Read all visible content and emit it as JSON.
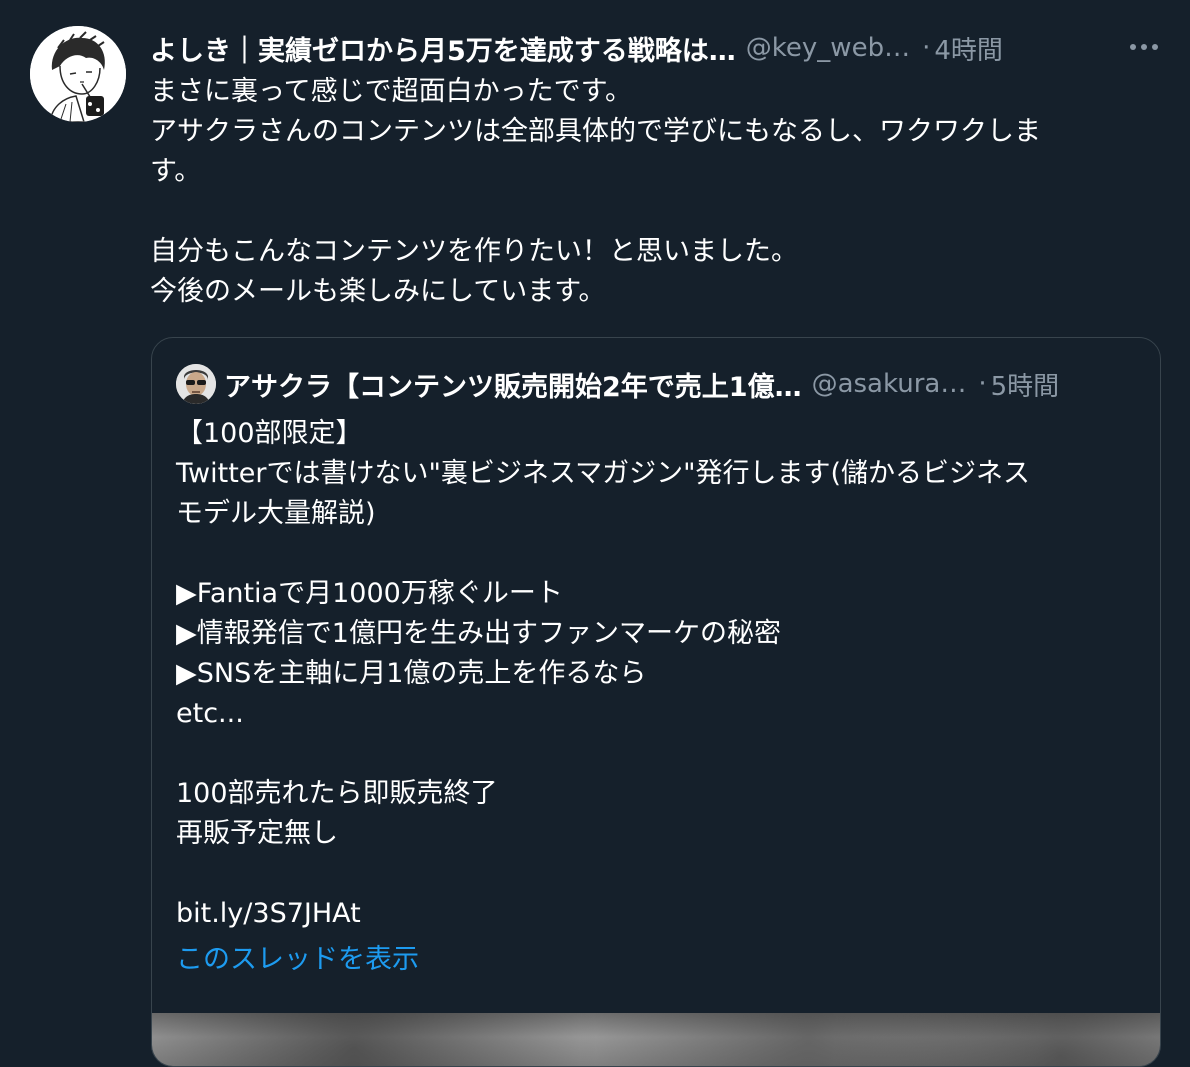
{
  "tweet": {
    "author_name": "よしき｜実績ゼロから月5万を達成する戦略は…",
    "author_handle": "@key_web…",
    "separator": "·",
    "time": "4時間",
    "body": "まさに裏って感じで超面白かったです。\nアサクラさんのコンテンツは全部具体的で学びにもなるし、ワクワクしま\nす。\n\n自分もこんなコンテンツを作りたい！と思いました。\n今後のメールも楽しみにしています。",
    "more_icon": "more-horizontal-icon"
  },
  "quote": {
    "author_name": "アサクラ【コンテンツ販売開始2年で売上1億…",
    "author_handle": "@asakura…",
    "separator": "·",
    "time": "5時間",
    "body": "【100部限定】\nTwitterでは書けない\"裏ビジネスマガジン\"発行します(儲かるビジネス\nモデル大量解説)\n\n▶Fantiaで月1000万稼ぐルート\n▶情報発信で1億円を生み出すファンマーケの秘密\n▶SNSを主軸に月1億の売上を作るなら\netc...\n\n100部売れたら即販売終了\n再販予定無し\n\nbit.ly/3S7JHAt",
    "show_thread": "このスレッドを表示"
  },
  "colors": {
    "background": "#15202b",
    "secondary_text": "#8b98a5",
    "link": "#1d9bf0",
    "border": "#38444d"
  }
}
